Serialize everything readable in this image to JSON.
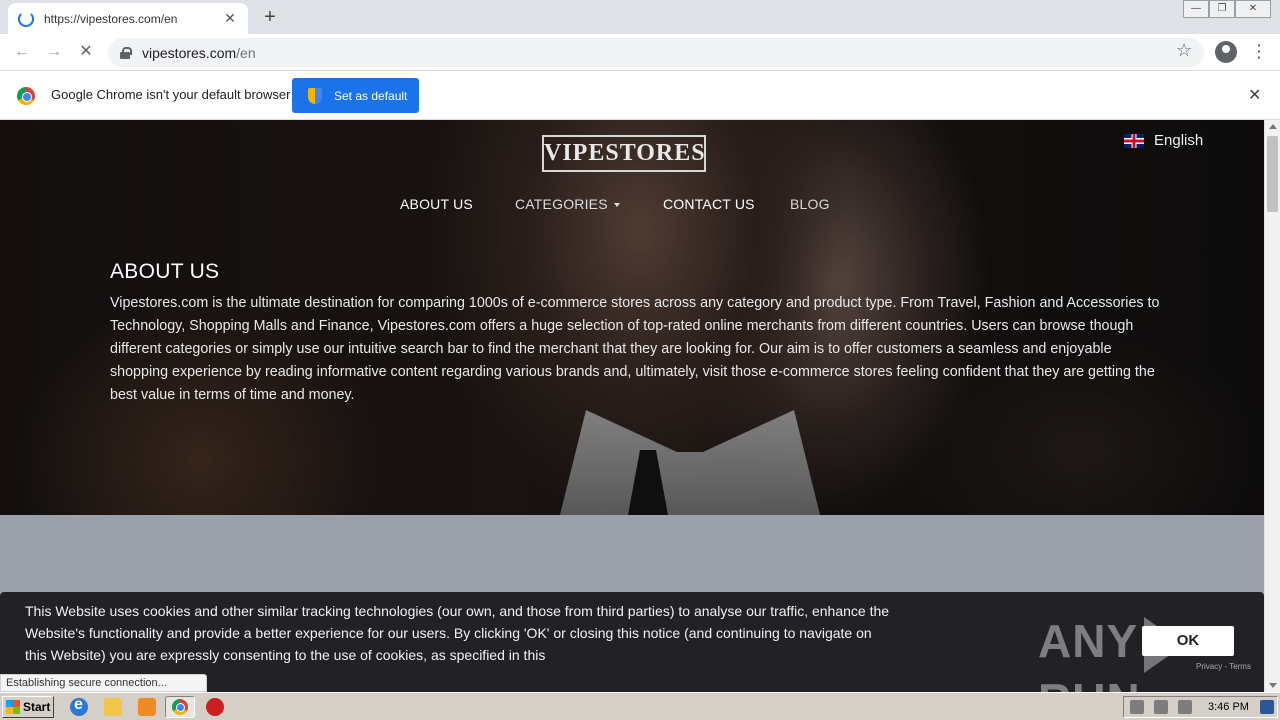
{
  "browser": {
    "tab_title": "https://vipestores.com/en",
    "tab_close": "✕",
    "new_tab": "+",
    "url_host": "vipestores.com",
    "url_path": "/en",
    "window_controls": [
      "—",
      "❐",
      "✕"
    ]
  },
  "infobar": {
    "message": "Google Chrome isn't your default browser",
    "button": "Set as default",
    "close": "✕"
  },
  "site": {
    "logo": "VIPESTORES",
    "language": "English",
    "nav": [
      "ABOUT US",
      "CATEGORIES",
      "CONTACT US",
      "BLOG"
    ],
    "about_title": "ABOUT US",
    "about_text": "Vipestores.com is the ultimate destination for comparing 1000s of e-commerce stores across any category and product type. From Travel, Fashion and Accessories to Technology, Shopping Malls and Finance, Vipestores.com offers a huge selection of top-rated online merchants from different countries. Users can browse though different categories or simply use our intuitive search bar to find the merchant that they are looking for. Our aim is to offer customers a seamless and enjoyable shopping experience by reading informative content regarding various brands and, ultimately, visit those e-commerce stores feeling confident that they are getting the best value in terms of time and money."
  },
  "cookie": {
    "text": "This Website uses cookies and other similar tracking technologies (our own, and those from third parties) to analyse our traffic, enhance the Website's functionality and provide a better experience for our users. By clicking 'OK' or closing this notice (and continuing to navigate on this Website) you are expressly consenting to the use of cookies, as specified in this",
    "ok": "OK",
    "watermark_left": "ANY",
    "watermark_right": "RUN",
    "recaptcha": "Privacy - Terms"
  },
  "status_text": "Establishing secure connection...",
  "taskbar": {
    "start": "Start",
    "clock": "3:46 PM"
  },
  "icons": [
    "spinner-icon",
    "back-icon",
    "forward-icon",
    "stop-icon",
    "lock-icon",
    "star-icon",
    "profile-icon",
    "menu-icon",
    "chrome-logo-icon",
    "shield-icon",
    "uk-flag-icon",
    "caret-down-icon",
    "windows-logo-icon",
    "ie-icon",
    "folder-icon",
    "media-player-icon",
    "chrome-icon",
    "stop-sign-icon"
  ],
  "colors": {
    "accent": "#1a73e8",
    "cookie_bg": "#19191c",
    "taskbar": "#d4d0c8"
  }
}
